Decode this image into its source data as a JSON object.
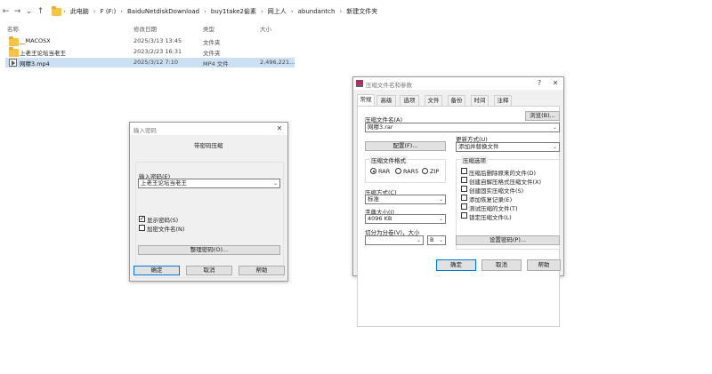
{
  "explorer": {
    "breadcrumbs": [
      "此电脑",
      "F (F:)",
      "BaiduNetdiskDownload",
      "buy1take2偷素",
      "网上人",
      "abundantch",
      "新建文件夹"
    ],
    "columns": {
      "name": "名称",
      "modified": "修改日期",
      "type": "类型",
      "size": "大小"
    },
    "files": [
      {
        "name": "__MACOSX",
        "modified": "2025/3/13 13:45",
        "type": "文件夹",
        "size": "",
        "icon": "folder-icon"
      },
      {
        "name": "上老王论坛当老王",
        "modified": "2023/2/23 16:31",
        "type": "文件夹",
        "size": "",
        "icon": "folder-icon"
      },
      {
        "name": "网穆3.mp4",
        "modified": "2025/3/12 7:10",
        "type": "MP4 文件",
        "size": "2,496,221...",
        "icon": "video-file-icon"
      }
    ]
  },
  "password_dialog": {
    "title": "输入密码",
    "heading": "带密码压缩",
    "input_label": "输入密码(E)",
    "password_value": "上老王论坛当老王",
    "show_password_label": "显示密码(S)",
    "show_password_checked": true,
    "encrypt_names_label": "加密文件名(N)",
    "encrypt_names_checked": false,
    "manage_label": "整理密码(O)...",
    "ok_label": "确定",
    "cancel_label": "取消",
    "help_label": "帮助"
  },
  "archive_dialog": {
    "title": "压缩文件名和参数",
    "help_btn": "?",
    "tabs": [
      "常规",
      "高级",
      "选项",
      "文件",
      "备份",
      "时间",
      "注释"
    ],
    "active_tab": 0,
    "archive_name_label": "压缩文件名(A)",
    "browse_label": "浏览(B)...",
    "archive_name_value": "网穆3.rar",
    "profile_label": "配置(F)...",
    "update_mode_label": "更新方式(U)",
    "update_mode_value": "添加并替换文件",
    "format_group": "压缩文件格式",
    "formats": [
      "RAR",
      "RAR5",
      "ZIP"
    ],
    "format_selected": 0,
    "method_label": "压缩方式(C)",
    "method_value": "标准",
    "dict_label": "字典大小(I)",
    "dict_value": "4096 KB",
    "split_label": "切分为分卷(V)，大小",
    "split_value": "",
    "split_unit": "B",
    "options_group": "压缩选项",
    "options": [
      {
        "label": "压缩后删除原来的文件(D)",
        "checked": false
      },
      {
        "label": "创建自解压格式压缩文件(X)",
        "checked": false
      },
      {
        "label": "创建固实压缩文件(S)",
        "checked": false
      },
      {
        "label": "添加恢复记录(E)",
        "checked": false
      },
      {
        "label": "测试压缩的文件(T)",
        "checked": false
      },
      {
        "label": "锁定压缩文件(L)",
        "checked": false
      }
    ],
    "set_password_label": "设置密码(P)...",
    "ok_label": "确定",
    "cancel_label": "取消",
    "help_label": "帮助"
  }
}
